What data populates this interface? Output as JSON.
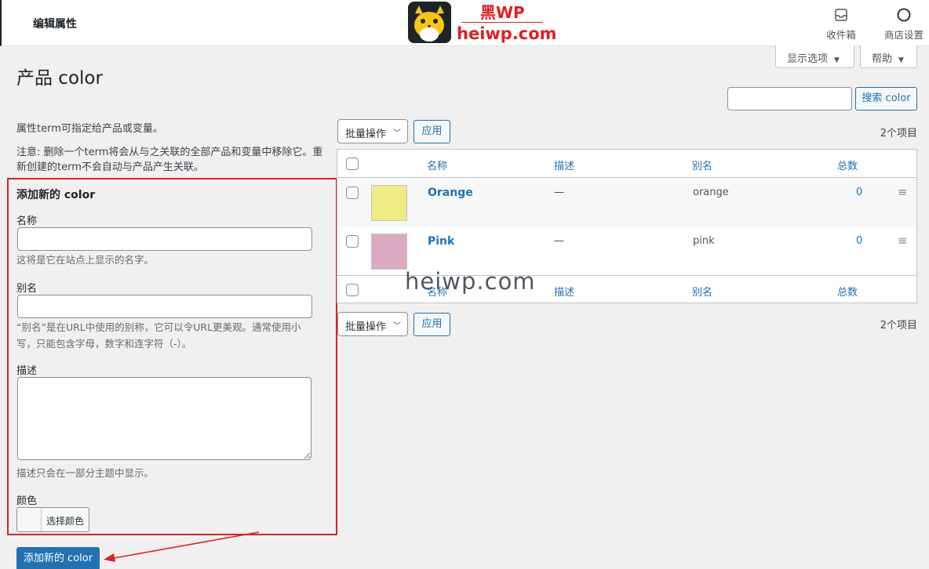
{
  "topbar": {
    "breadcrumb": "编辑属性",
    "logo_top": "黑WP",
    "logo_site": "heiwp.com",
    "inbox_label": "收件箱",
    "store_label": "商店设置"
  },
  "screen": {
    "options_label": "显示选项",
    "help_label": "帮助"
  },
  "page_title": "产品 color",
  "search": {
    "placeholder": "",
    "button_label": "搜索 color"
  },
  "intro": {
    "line1": "属性term可指定给产品或变量。",
    "line2": "注意: 删除一个term将会从与之关联的全部产品和变量中移除它。重新创建的term不会自动与产品产生关联。"
  },
  "form": {
    "title": "添加新的 color",
    "name_label": "名称",
    "name_value": "",
    "name_help": "这将是它在站点上显示的名字。",
    "slug_label": "别名",
    "slug_value": "",
    "slug_help": "“别名”是在URL中使用的别称，它可以令URL更美观。通常使用小写，只能包含字母，数字和连字符（-）。",
    "desc_label": "描述",
    "desc_value": "",
    "desc_help": "描述只会在一部分主题中显示。",
    "color_label": "颜色",
    "color_button": "选择颜色",
    "submit_label": "添加新的 color"
  },
  "bulk": {
    "label": "批量操作",
    "apply": "应用",
    "count": "2个项目"
  },
  "table": {
    "headers": {
      "name": "名称",
      "description": "描述",
      "slug": "别名",
      "total": "总数"
    },
    "rows": [
      {
        "color": "#eeec82",
        "name": "Orange",
        "description": "—",
        "slug": "orange",
        "total": "0"
      },
      {
        "color": "#dcaac0",
        "name": "Pink",
        "description": "—",
        "slug": "pink",
        "total": "0"
      }
    ]
  },
  "watermark": "heiwp.com",
  "colors": {
    "accent": "#2271b1",
    "highlight_red": "#e02020"
  }
}
